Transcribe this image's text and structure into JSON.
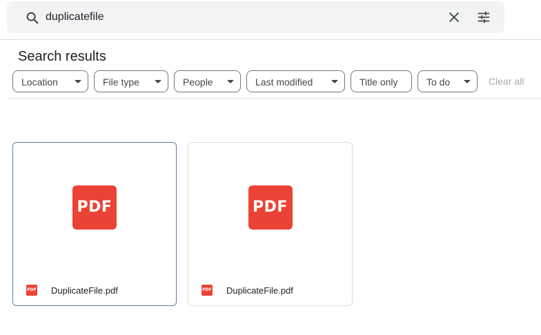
{
  "search": {
    "query": "duplicatefile",
    "search_icon": "search-icon",
    "clear_icon": "close-icon",
    "options_icon": "tune-icon"
  },
  "results": {
    "title": "Search results"
  },
  "filters": {
    "chips": [
      {
        "label": "Location",
        "has_dropdown": true
      },
      {
        "label": "File type",
        "has_dropdown": true
      },
      {
        "label": "People",
        "has_dropdown": true
      },
      {
        "label": "Last modified",
        "has_dropdown": true
      },
      {
        "label": "Title only",
        "has_dropdown": false
      },
      {
        "label": "To do",
        "has_dropdown": true
      }
    ],
    "clear_all": "Clear all"
  },
  "files": [
    {
      "name": "DuplicateFile.pdf",
      "thumb_label": "PDF",
      "badge_label": "PDF",
      "selected": true
    },
    {
      "name": "DuplicateFile.pdf",
      "thumb_label": "PDF",
      "badge_label": "PDF",
      "selected": false
    }
  ],
  "colors": {
    "pdf_red": "#ea4335",
    "search_bg": "#f1f3f4",
    "selected_border": "#5a7da7",
    "disabled_text": "#a8abaf"
  }
}
